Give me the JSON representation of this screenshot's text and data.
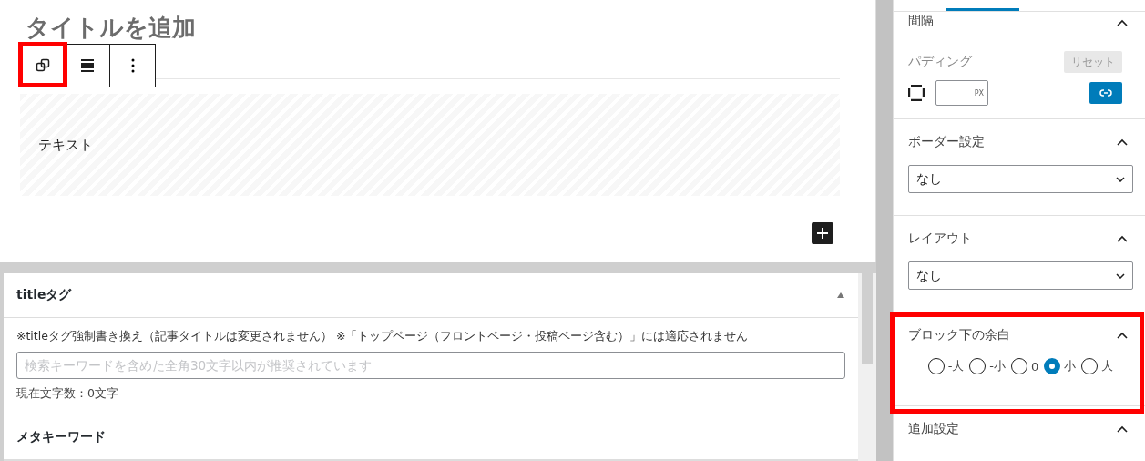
{
  "editor": {
    "title_placeholder": "タイトルを追加",
    "block_text": "テキスト"
  },
  "meta_boxes": [
    {
      "title": "titleタグ",
      "expanded": true,
      "note": "※titleタグ強制書き換え（記事タイトルは変更されません） ※「トップページ（フロントページ・投稿ページ含む）」には適応されません",
      "placeholder": "検索キーワードを含めた全角30文字以内が推奨されています",
      "count": "現在文字数：0文字"
    },
    {
      "title": "メタキーワード"
    }
  ],
  "sidebar": {
    "spacing": {
      "title": "間隔",
      "padding_label": "パディング",
      "reset": "リセット",
      "unit": "PX"
    },
    "sections": [
      {
        "kind": "select",
        "title": "ボーダー設定",
        "value": "なし"
      },
      {
        "kind": "select",
        "title": "レイアウト",
        "value": "なし"
      },
      {
        "kind": "radio",
        "title": "ブロック下の余白",
        "options": [
          {
            "label": "-大",
            "selected": false
          },
          {
            "label": "-小",
            "selected": false
          },
          {
            "label": "0",
            "selected": false
          },
          {
            "label": "小",
            "selected": true
          },
          {
            "label": "大",
            "selected": false
          }
        ]
      },
      {
        "kind": "plain",
        "title": "追加設定"
      }
    ]
  }
}
